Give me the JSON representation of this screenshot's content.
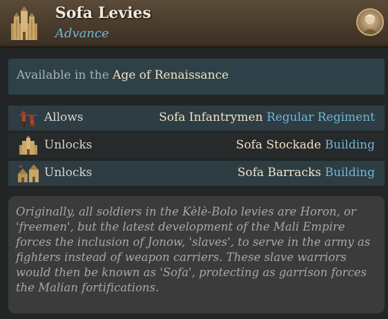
{
  "header": {
    "title": "Sofa Levies",
    "subtitle": "Advance",
    "icon": "fortress-icon"
  },
  "availability": {
    "prefix": "Available in the",
    "age": "Age of Renaissance"
  },
  "rows": [
    {
      "label": "Allows",
      "value": "Sofa Infantrymen",
      "type": "Regular Regiment",
      "icon": "infantry-icon"
    },
    {
      "label": "Unlocks",
      "value": "Sofa Stockade",
      "type": "Building",
      "icon": "stockade-icon"
    },
    {
      "label": "Unlocks",
      "value": "Sofa Barracks",
      "type": "Building",
      "icon": "barracks-icon"
    }
  ],
  "description": "Originally, all soldiers in the Kèlè-Bolo levies are Horon, or 'freemen', but the latest development of the Mali Empire forces the inclusion of Jonow, 'slaves', to serve in the army as fighters instead of weapon carriers. These slave warriors would then be known as 'Sofa', protecting as garrison forces the Malian fortifications.",
  "colors": {
    "accent_blue": "#6fb7d4",
    "highlight": "#efe3c4",
    "header_bg": "#4a3c2d"
  }
}
